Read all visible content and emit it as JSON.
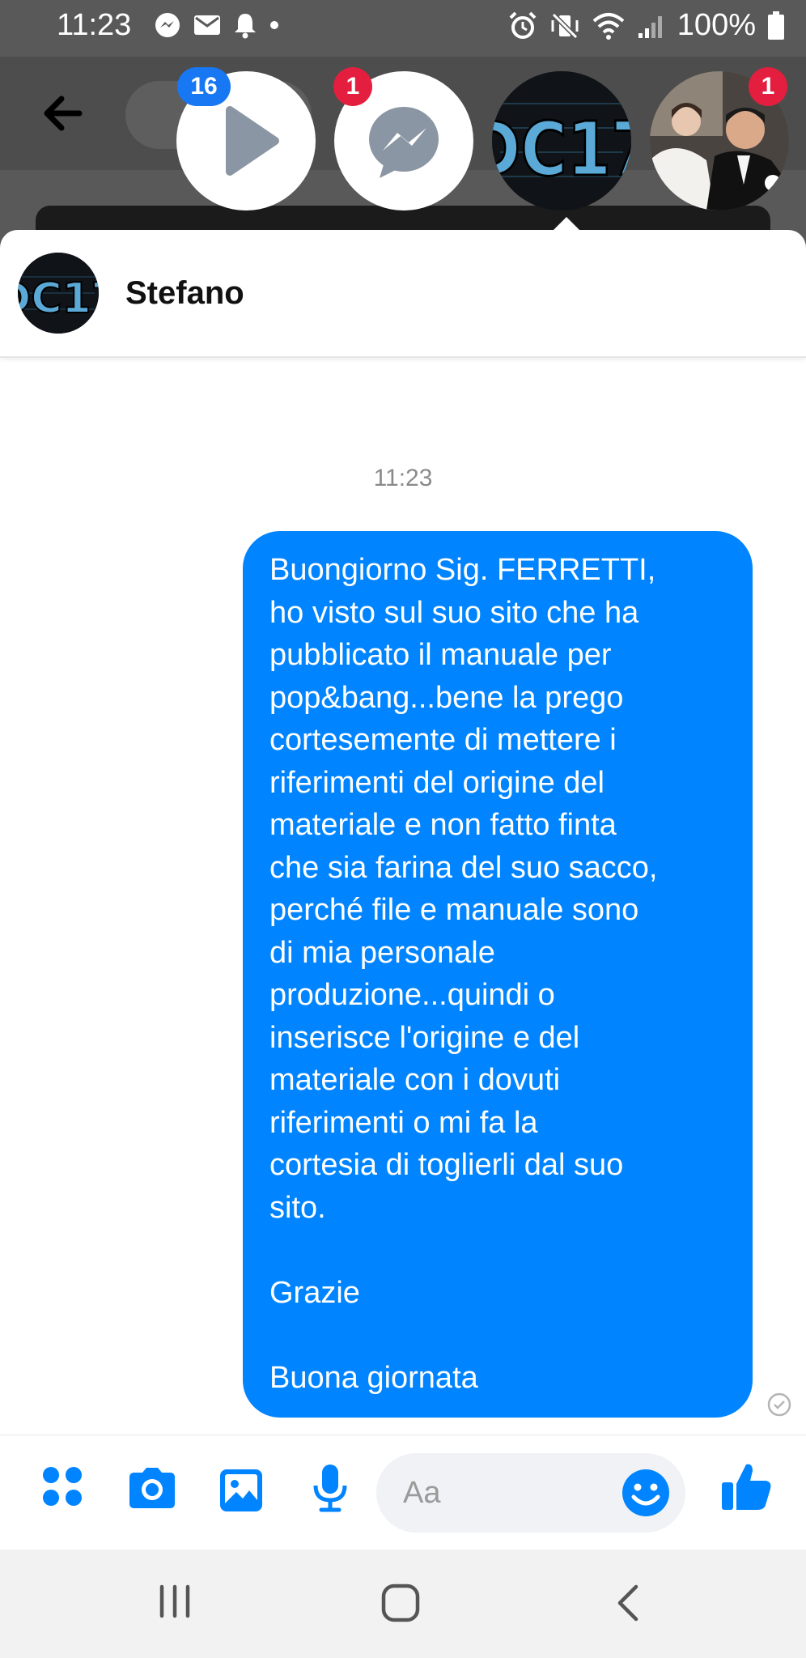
{
  "status_bar": {
    "time": "11:23",
    "battery": "100%"
  },
  "chat_heads": [
    {
      "name": "video-play",
      "badge": "16",
      "badge_color": "#1877f2"
    },
    {
      "name": "messenger",
      "badge": "1",
      "badge_color": "#e41e3f"
    },
    {
      "name": "dc17-logo",
      "badge": ""
    },
    {
      "name": "couple-photo",
      "badge": "1",
      "badge_color": "#e41e3f"
    }
  ],
  "conversation": {
    "contact_name": "Stefano",
    "timestamp": "11:23",
    "message": "Buongiorno Sig. FERRETTI,\nho visto sul suo sito che ha\npubblicato il manuale per\npop&bang...bene la prego\ncortesemente di mettere i\nriferimenti del origine del\nmateriale e non fatto finta\nche sia farina del suo sacco,\nperché file e manuale sono\ndi mia personale\nproduzione...quindi o\ninserisce l'origine e del\nmateriale con i dovuti\nriferimenti o mi fa la\ncortesia di toglierli dal suo\nsito.\n\nGrazie\n\nBuona giornata",
    "bubble_color": "#0084ff"
  },
  "composer": {
    "placeholder": "Aa",
    "accent": "#0084ff"
  },
  "logo_text": "DC17"
}
